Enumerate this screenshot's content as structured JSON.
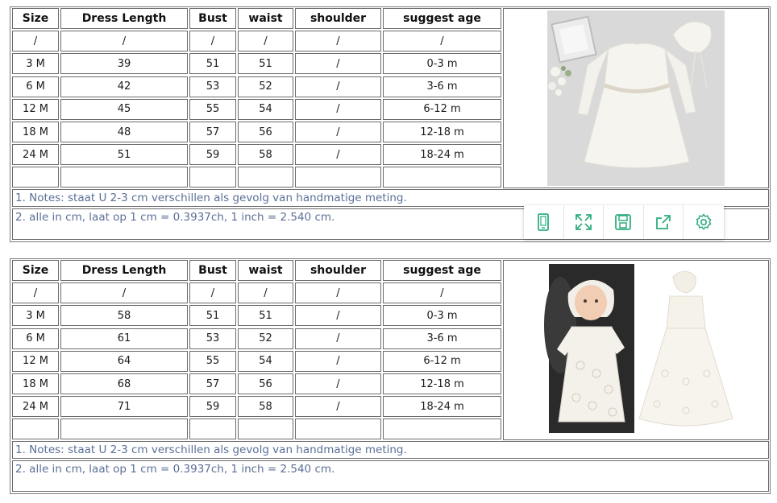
{
  "table1": {
    "headers": [
      "Size",
      "Dress Length",
      "Bust",
      "waist",
      "shoulder",
      "suggest age"
    ],
    "rows": [
      [
        "/",
        "/",
        "/",
        "/",
        "/",
        "/"
      ],
      [
        "3 M",
        "39",
        "51",
        "51",
        "/",
        "0-3 m"
      ],
      [
        "6 M",
        "42",
        "53",
        "52",
        "/",
        "3-6 m"
      ],
      [
        "12 M",
        "45",
        "55",
        "54",
        "/",
        "6-12 m"
      ],
      [
        "18 M",
        "48",
        "57",
        "56",
        "/",
        "12-18 m"
      ],
      [
        "24 M",
        "51",
        "59",
        "58",
        "/",
        "18-24 m"
      ],
      [
        "",
        "",
        "",
        "",
        "",
        ""
      ]
    ],
    "note1": "1. Notes: staat U 2-3 cm verschillen als gevolg van handmatige meting.",
    "note2": "2. alle in cm, laat op 1 cm = 0.3937ch, 1 inch = 2.540 cm."
  },
  "table2": {
    "headers": [
      "Size",
      "Dress Length",
      "Bust",
      "waist",
      "shoulder",
      "suggest age"
    ],
    "rows": [
      [
        "/",
        "/",
        "/",
        "/",
        "/",
        "/"
      ],
      [
        "3 M",
        "58",
        "51",
        "51",
        "/",
        "0-3 m"
      ],
      [
        "6 M",
        "61",
        "53",
        "52",
        "/",
        "3-6 m"
      ],
      [
        "12 M",
        "64",
        "55",
        "54",
        "/",
        "6-12 m"
      ],
      [
        "18 M",
        "68",
        "57",
        "56",
        "/",
        "12-18 m"
      ],
      [
        "24 M",
        "71",
        "59",
        "58",
        "/",
        "18-24 m"
      ],
      [
        "",
        "",
        "",
        "",
        "",
        ""
      ]
    ],
    "note1": "1. Notes: staat U 2-3 cm verschillen als gevolg van handmatige meting.",
    "note2": "2. alle in cm, laat op 1 cm = 0.3937ch, 1 inch = 2.540 cm."
  },
  "toolbar": {
    "icons": [
      "phone-icon",
      "expand-icon",
      "save-icon",
      "share-icon",
      "settings-icon"
    ],
    "accent": "#2fae7d"
  }
}
